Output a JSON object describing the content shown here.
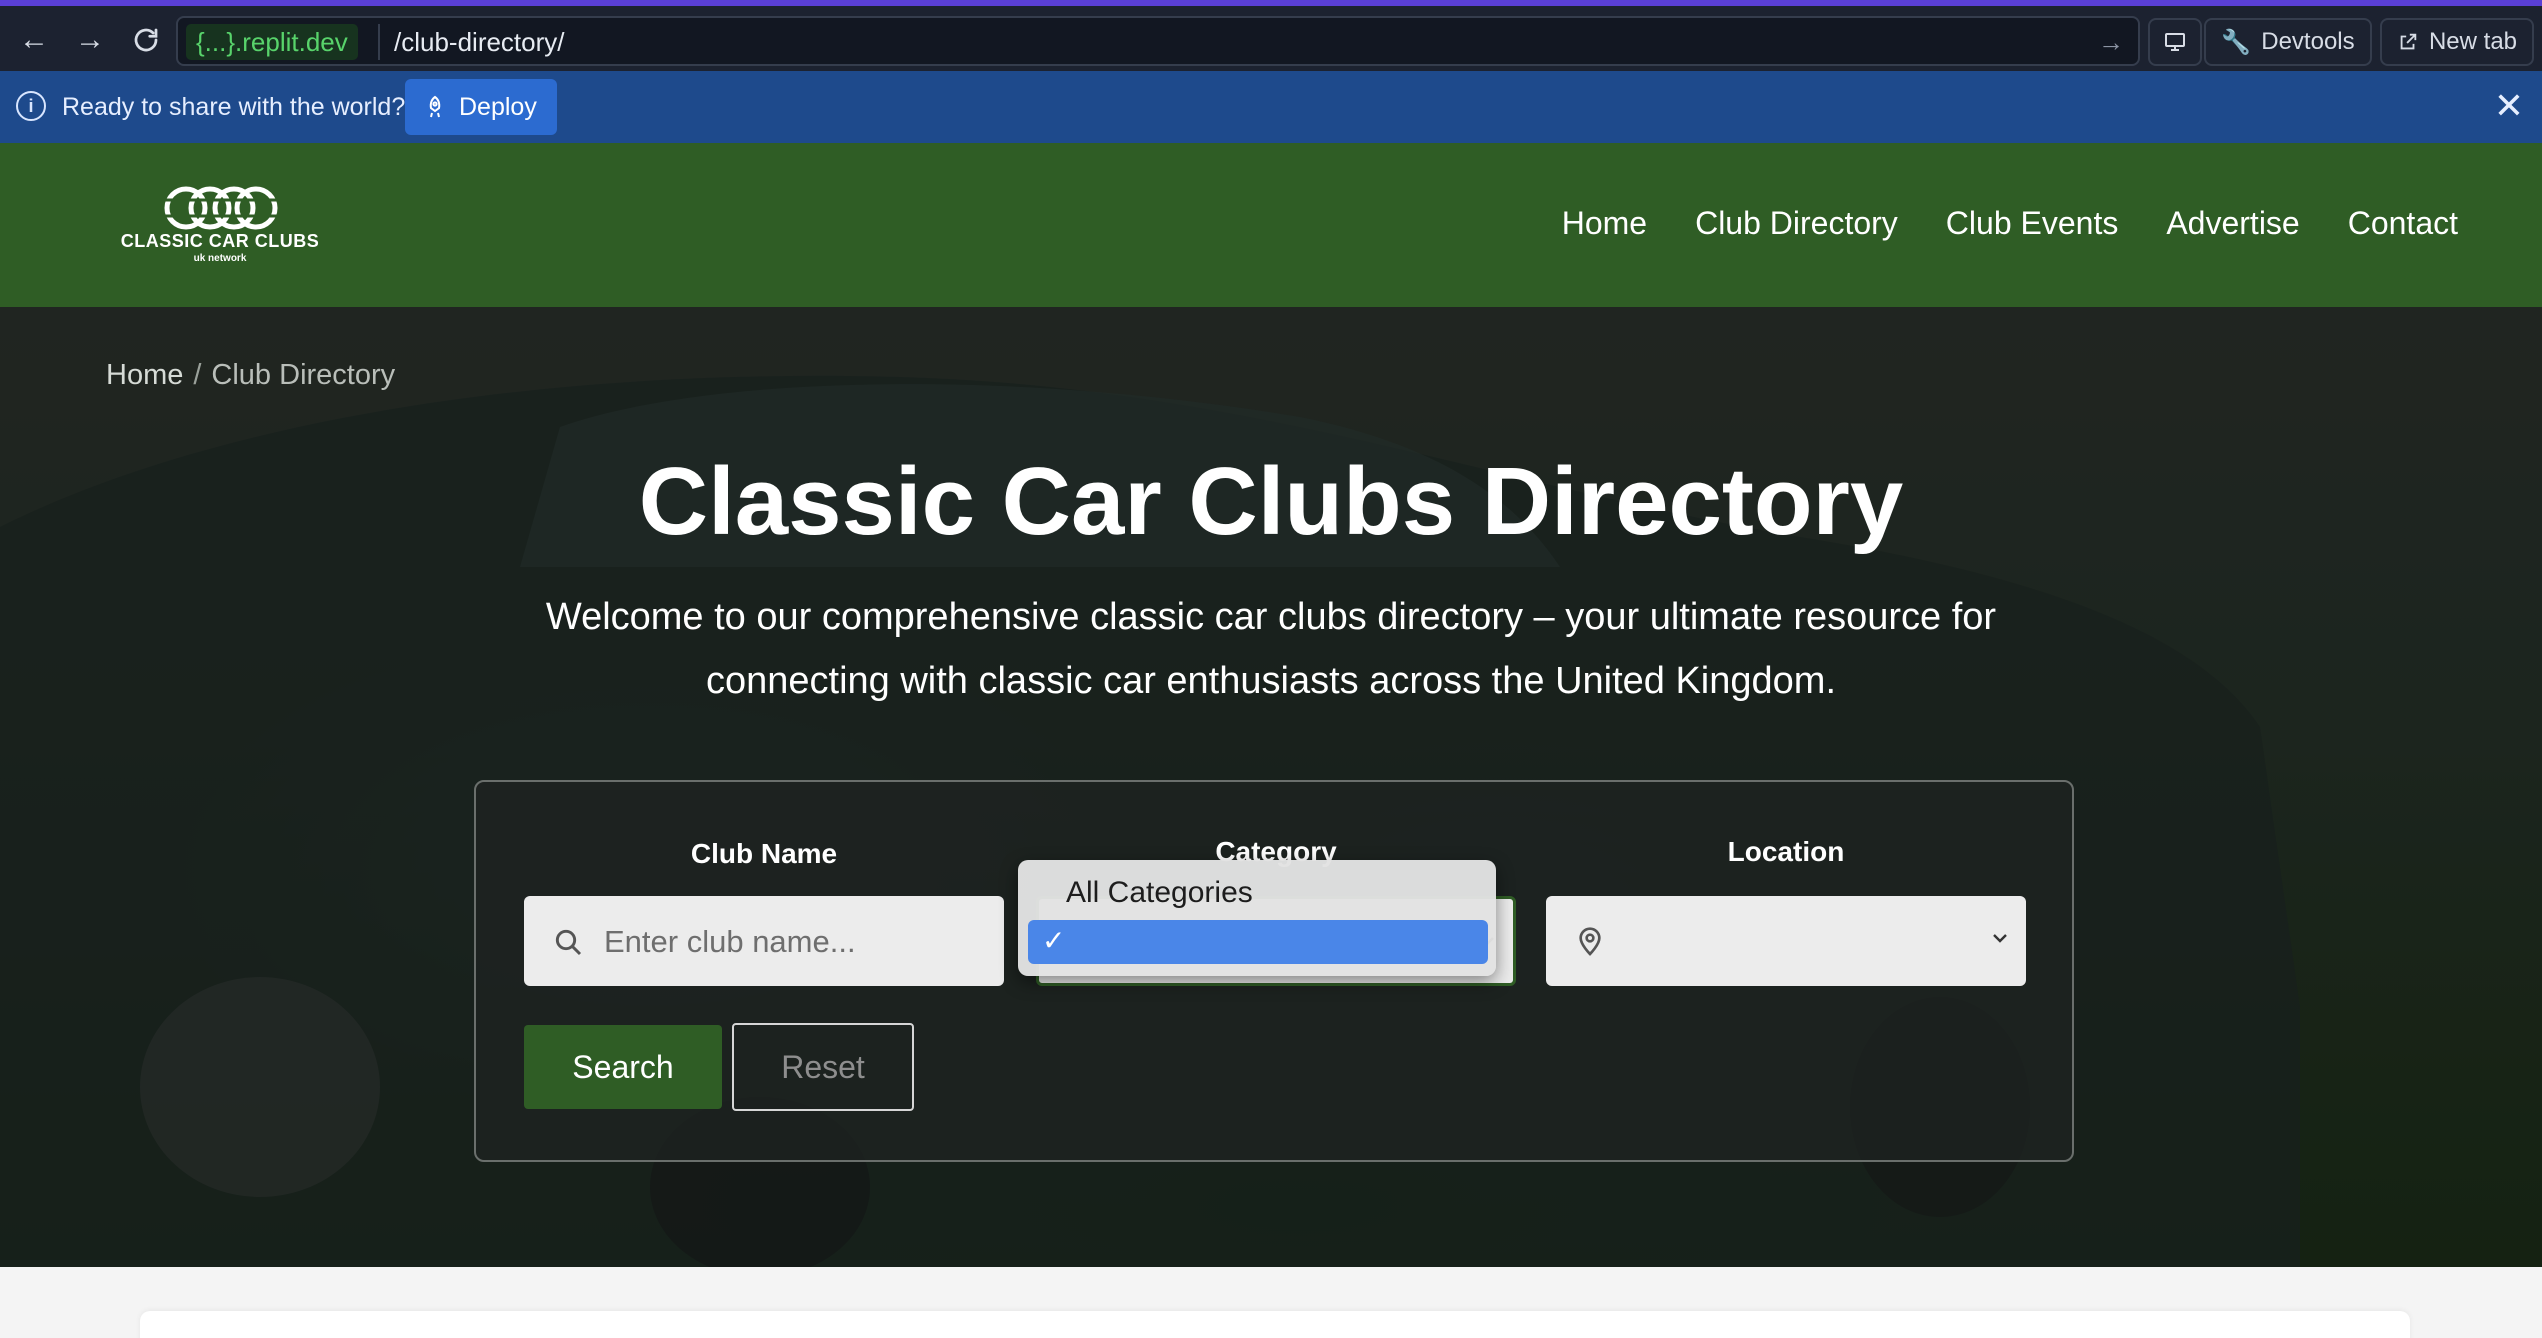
{
  "browser": {
    "url_host": "{...}.replit.dev",
    "url_path": "/club-directory/",
    "devtools_label": "Devtools",
    "new_tab_label": "New tab"
  },
  "banner": {
    "message": "Ready to share with the world?",
    "deploy_label": "Deploy"
  },
  "site": {
    "logo_title": "CLASSIC CAR CLUBS",
    "logo_sub": "uk network",
    "nav": [
      "Home",
      "Club Directory",
      "Club Events",
      "Advertise",
      "Contact"
    ]
  },
  "breadcrumb": {
    "home": "Home",
    "separator": "/",
    "current": "Club Directory"
  },
  "hero": {
    "title": "Classic Car Clubs Directory",
    "description": "Welcome to our comprehensive classic car clubs directory – your ultimate resource for connecting with classic car enthusiasts across the United Kingdom."
  },
  "search": {
    "club_name_label": "Club Name",
    "club_name_placeholder": "Enter club name...",
    "category_label": "Category",
    "location_label": "Location",
    "location_value": "",
    "search_label": "Search",
    "reset_label": "Reset"
  },
  "category_dropdown": {
    "options": [
      "All Categories",
      ""
    ],
    "selected_index": 1
  },
  "colors": {
    "brand_green": "#2f5d25",
    "banner_blue": "#1e4a8c",
    "deploy_blue": "#2c6bd0",
    "dropdown_highlight": "#4a86e8"
  },
  "icons": {
    "back": "back-arrow-icon",
    "forward": "forward-arrow-icon",
    "reload": "reload-icon",
    "info": "info-icon",
    "deploy": "rocket-icon",
    "close": "close-icon",
    "search": "search-icon",
    "location": "map-pin-icon",
    "chevron": "chevron-down-icon",
    "check": "checkmark-icon"
  }
}
